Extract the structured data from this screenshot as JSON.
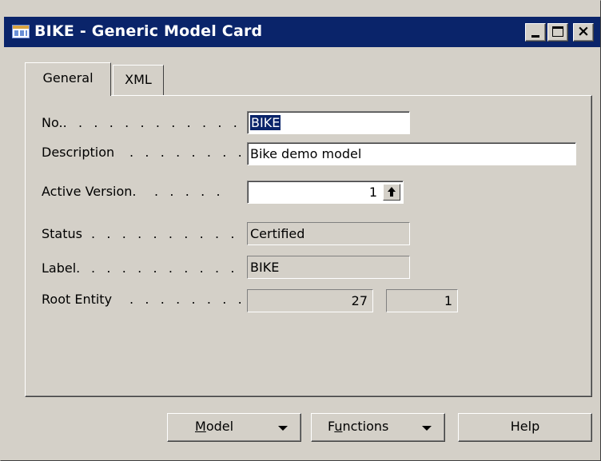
{
  "window": {
    "title": "BIKE - Generic Model Card",
    "icon": "table-form-icon"
  },
  "tabs": [
    {
      "label": "General",
      "active": true
    },
    {
      "label": "XML",
      "active": false
    }
  ],
  "fields": {
    "no": {
      "label": "No..",
      "dots": ". . . . . . . . . . .",
      "value": "BIKE"
    },
    "description": {
      "label": "Description",
      "dots": ". . . . . . . .",
      "value": "Bike demo model"
    },
    "active_version": {
      "label": "Active Version.",
      "dots": ". . . . .",
      "value": "1"
    },
    "status": {
      "label": "Status",
      "dots": ". . . . . . . . . . .",
      "value": "Certified"
    },
    "label": {
      "label": "Label.",
      "dots": ". . . . . . . . . .",
      "value": "BIKE"
    },
    "root_entity": {
      "label": "Root Entity",
      "dots": ". . . . . . . .",
      "value1": "27",
      "value2": "1"
    }
  },
  "buttons": {
    "model": {
      "pre": "",
      "accel": "M",
      "post": "odel"
    },
    "functions": {
      "pre": "F",
      "accel": "u",
      "post": "nctions"
    },
    "help": "Help"
  },
  "colors": {
    "titlebar": "#0a246a",
    "face": "#d4d0c8",
    "selection": "#0a246a"
  }
}
